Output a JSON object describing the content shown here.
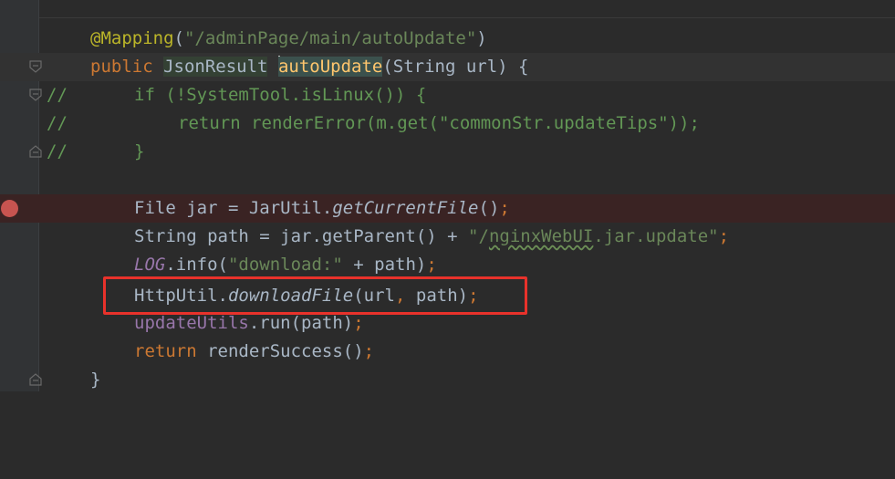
{
  "editor": {
    "annotation": "@Mapping",
    "annotation_arg": "\"/adminPage/main/autoUpdate\"",
    "lines": {
      "l1_paren_open": "(",
      "l1_paren_close": ")",
      "kw_public": "public",
      "type_jsonresult": "JsonResult",
      "method_name": "autoUpdate",
      "params": "(String url) {",
      "cmt1_prefix": "//",
      "cmt1_code": "if (!SystemTool.isLinux()) {",
      "cmt2_prefix": "//",
      "cmt2_code": "return renderError(m.get(\"commonStr.updateTips\"));",
      "cmt3_prefix": "//",
      "cmt3_code": "}",
      "l7_a": "File jar = JarUtil.",
      "l7_b": "getCurrentFile",
      "l7_c": "()",
      "l7_d": ";",
      "l8_a": "String path = jar.getParent() + ",
      "l8_str_q": "\"/",
      "l8_str_word": "nginxWebUI",
      "l8_str_rest": ".jar.update\"",
      "l8_semi": ";",
      "l9_field": "LOG",
      "l9_a": ".info(",
      "l9_str": "\"download:\"",
      "l9_b": " + path)",
      "l9_semi": ";",
      "l10_a": "HttpUtil.",
      "l10_b": "downloadFile",
      "l10_c": "(url",
      "l10_comma": ",",
      "l10_d": " path)",
      "l10_semi": ";",
      "l11_a": "updateUtils",
      "l11_b": ".run(path)",
      "l11_semi": ";",
      "kw_return": "return",
      "l12_a": " renderSuccess()",
      "l12_semi": ";",
      "closing_brace": "}"
    }
  },
  "colors": {
    "background": "#2b2b2b",
    "keyword": "#cc7832",
    "string": "#6a8759",
    "annotation": "#bbb529",
    "method_decl": "#ffc66d",
    "field": "#9876aa",
    "breakpoint": "#c75450",
    "highlight_box": "#e8322b"
  }
}
